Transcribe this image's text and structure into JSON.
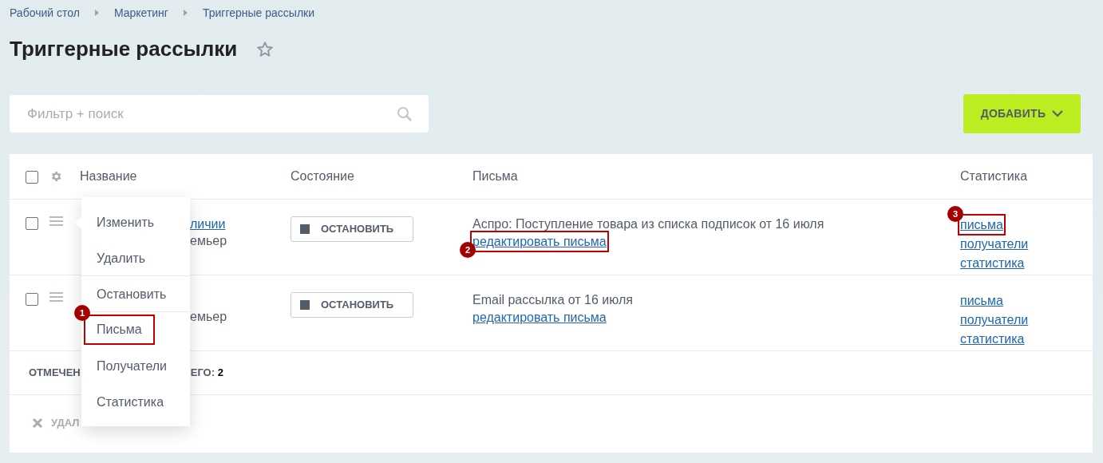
{
  "breadcrumbs": [
    "Рабочий стол",
    "Маркетинг",
    "Триггерные рассылки"
  ],
  "title": "Триггерные рассылки",
  "favorite": false,
  "search": {
    "placeholder": "Фильтр + поиск"
  },
  "add_button": "ДОБАВИТЬ",
  "table": {
    "columns": [
      "Название",
      "Состояние",
      "Письма",
      "Статистика"
    ],
    "select_all": false,
    "rows": [
      {
        "checked": false,
        "name_link": "личии",
        "name_text": "емьер",
        "state_button": "ОСТАНОВИТЬ",
        "letter_title": "Аспро: Поступление товара из списка подписок от 16 июля",
        "letter_link": {
          "label": "редактировать письма",
          "annotation": "2"
        },
        "stats": [
          {
            "label": "письма",
            "annotation": "3"
          },
          {
            "label": "получатели"
          },
          {
            "label": "статистика"
          }
        ]
      },
      {
        "checked": false,
        "name_text": "емьер",
        "state_button": "ОСТАНОВИТЬ",
        "letter_title": "Email рассылка от 16 июля",
        "letter_link": {
          "label": "редактировать письма"
        },
        "stats": [
          {
            "label": "письма"
          },
          {
            "label": "получатели"
          },
          {
            "label": "статистика"
          }
        ]
      }
    ],
    "footer": {
      "selected_label": "ОТМЕЧЕН",
      "total_label": "ЕГО:",
      "total": "2"
    },
    "action": "УДАЛ"
  },
  "context_menu": [
    {
      "label": "Изменить"
    },
    {
      "label": "Удалить",
      "divider_after": true
    },
    {
      "label": "Остановить",
      "divider_after": true
    },
    {
      "label": "Письма",
      "annotation": "1"
    },
    {
      "label": "Получатели"
    },
    {
      "label": "Статистика"
    }
  ]
}
